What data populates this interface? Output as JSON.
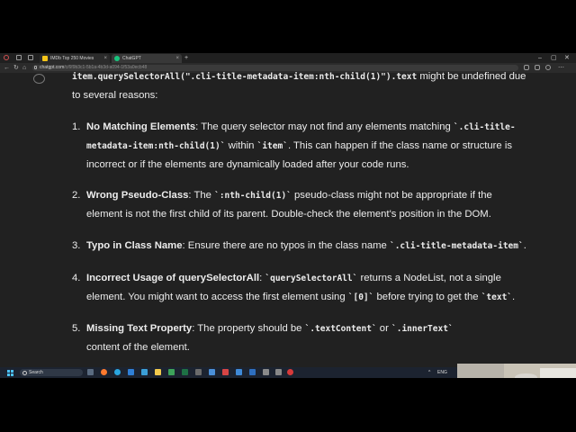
{
  "browser": {
    "tabs": [
      {
        "title": "IMDb Top 250 Movies",
        "fav_color": "#f5c518"
      },
      {
        "title": "ChatGPT",
        "fav_color": "#19c37d"
      }
    ],
    "new_tab": "+",
    "url_domain": "chatgpt.com",
    "url_path": "/c/6f9b3c1-5b1a-4b3d-a094-1f53a0ecb48"
  },
  "chat": {
    "intro_prefix_code": "item.querySelectorAll(\".cli-title-metadata-item:nth-child(1)\").text",
    "intro_suffix": " might be undefined due",
    "intro_line2": "to several reasons:",
    "items": [
      {
        "number": "1.",
        "title": "No Matching Elements",
        "l1_text": ": The query selector may not find any elements matching ",
        "l1_code": "`.cli-title-",
        "l2_code1": "metadata-item:nth-child(1)`",
        "l2_text1": " within ",
        "l2_code2": "`item`",
        "l2_text2": ". This can happen if the class name or structure is",
        "l3_text": "incorrect or if the elements are dynamically loaded after your code runs."
      },
      {
        "number": "2.",
        "title": "Wrong Pseudo-Class",
        "l1_text1": ": The ",
        "l1_code": "`:nth-child(1)`",
        "l1_text2": " pseudo-class might not be appropriate if the",
        "l2_text": "element is not the first child of its parent. Double-check the element's position in the DOM."
      },
      {
        "number": "3.",
        "title": "Typo in Class Name",
        "l1_text1": ": Ensure there are no typos in the class name ",
        "l1_code": "`.cli-title-metadata-item`",
        "l1_text2": "."
      },
      {
        "number": "4.",
        "title": "Incorrect Usage of querySelectorAll",
        "l1_text1": ": ",
        "l1_code": "`querySelectorAll`",
        "l1_text2": " returns a NodeList, not a single",
        "l2_text1": "element. You might want to access the first element using ",
        "l2_code1": "`[0]`",
        "l2_text2": " before trying to get the ",
        "l2_code2": "`text`",
        "l2_text3": "."
      },
      {
        "number": "5.",
        "title": "Missing Text Property",
        "l1_text1": ": The property should be ",
        "l1_code1": "`.textContent`",
        "l1_text2": " or ",
        "l1_code2": "`.innerText`",
        "l2_text": "content of the element."
      }
    ]
  },
  "taskbar": {
    "search_label": "Search",
    "tray_text": "ENG"
  },
  "colors": {
    "chat_bg": "#212121",
    "text": "#ececec",
    "taskbar_bg": "#1c2330"
  }
}
